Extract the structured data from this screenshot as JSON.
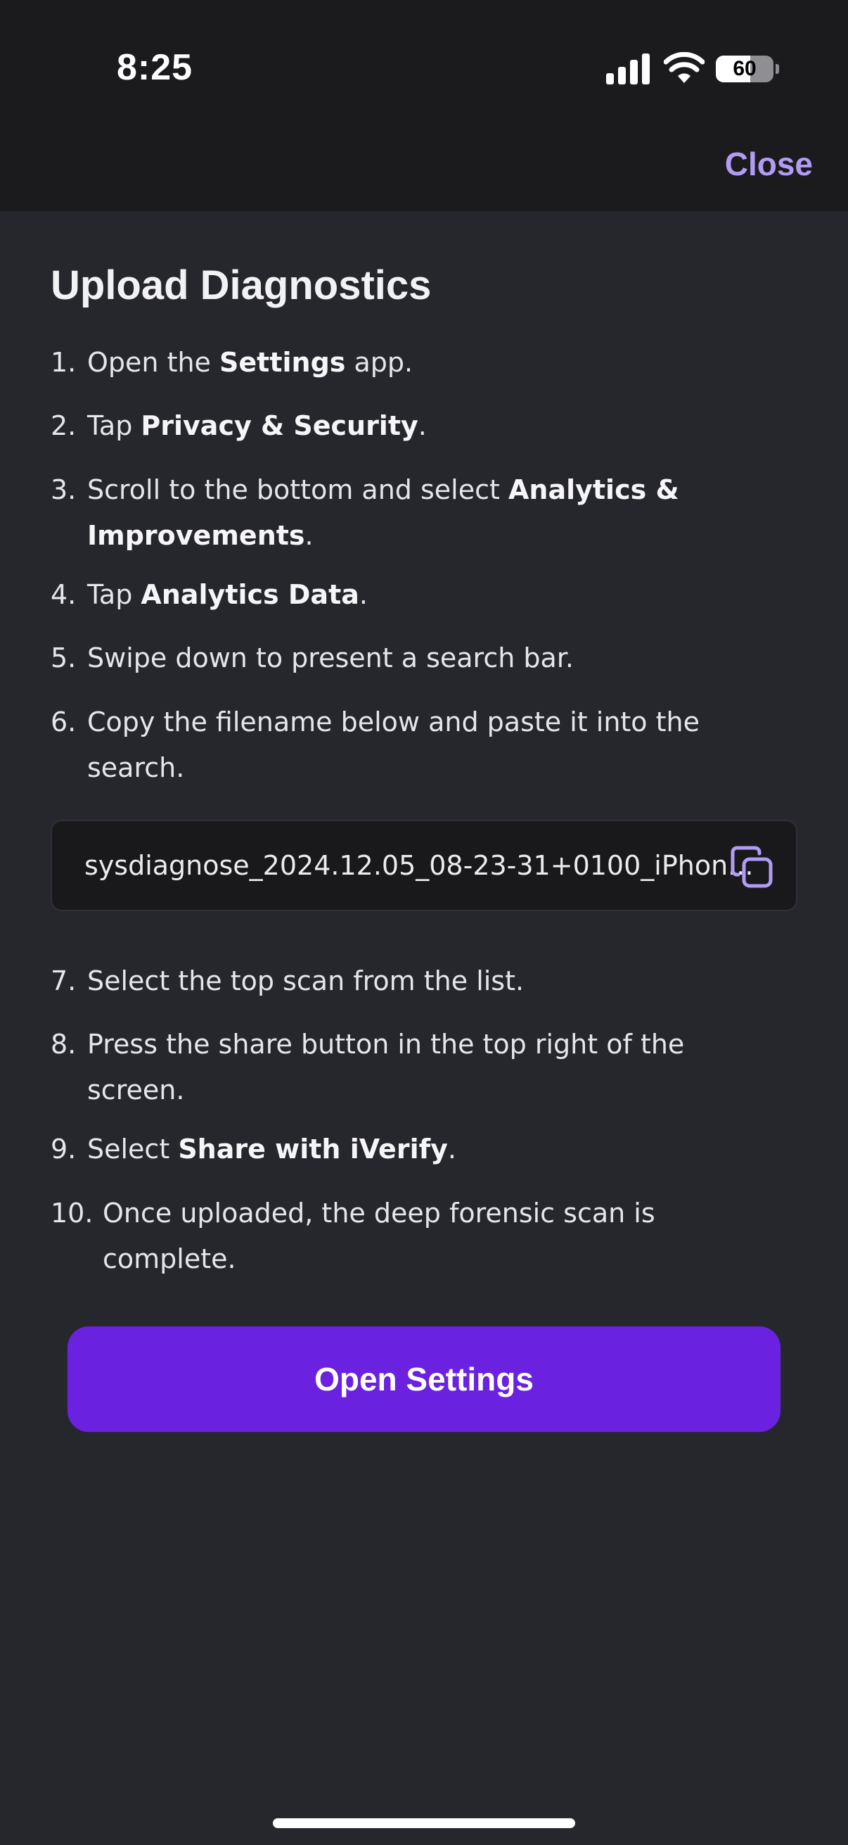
{
  "status_bar": {
    "time": "8:25",
    "battery": "60",
    "battery_level": 0.6
  },
  "header": {
    "close_label": "Close"
  },
  "title": "Upload Diagnostics",
  "steps": [
    {
      "num": "1.",
      "parts": [
        {
          "t": "Open the "
        },
        {
          "t": "Settings",
          "b": true
        },
        {
          "t": " app."
        }
      ]
    },
    {
      "num": "2.",
      "parts": [
        {
          "t": "Tap "
        },
        {
          "t": "Privacy & Security",
          "b": true
        },
        {
          "t": "."
        }
      ]
    },
    {
      "num": "3.",
      "parts": [
        {
          "t": "Scroll to the bottom and select "
        },
        {
          "t": "Analytics & Improvements",
          "b": true
        },
        {
          "t": "."
        }
      ]
    },
    {
      "num": "4.",
      "parts": [
        {
          "t": "Tap "
        },
        {
          "t": "Analytics Data",
          "b": true
        },
        {
          "t": "."
        }
      ]
    },
    {
      "num": "5.",
      "parts": [
        {
          "t": "Swipe down to present a search bar."
        }
      ]
    },
    {
      "num": "6.",
      "parts": [
        {
          "t": "Copy the filename below and paste it into the search."
        }
      ]
    },
    {
      "num": "7.",
      "parts": [
        {
          "t": "Select the top scan from the list."
        }
      ]
    },
    {
      "num": "8.",
      "parts": [
        {
          "t": "Press the share button in the top right of the screen."
        }
      ]
    },
    {
      "num": "9.",
      "parts": [
        {
          "t": "Select "
        },
        {
          "t": "Share with iVerify",
          "b": true
        },
        {
          "t": "."
        }
      ]
    },
    {
      "num": "10.",
      "parts": [
        {
          "t": "Once uploaded, the deep forensic scan is complete."
        }
      ]
    }
  ],
  "filename": "sysdiagnose_2024.12.05_08-23-31+0100_iPhon...",
  "open_settings_label": "Open Settings",
  "colors": {
    "accent": "#6a22e0",
    "close_link": "#b29cf3",
    "background": "#26272d",
    "header_bg": "#1b1b1e"
  },
  "icons": [
    "signal-icon",
    "wifi-icon",
    "battery-icon",
    "copy-icon"
  ]
}
